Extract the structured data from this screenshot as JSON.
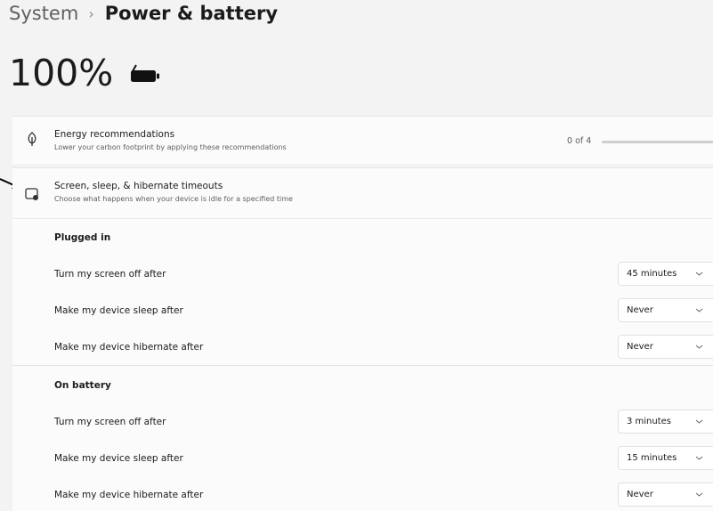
{
  "breadcrumb": {
    "root": "System",
    "separator": "›",
    "current": "Power & battery"
  },
  "battery": {
    "percent": "100%",
    "icon": "battery-charging-icon"
  },
  "energy_recommendations": {
    "icon": "leaf-icon",
    "title": "Energy recommendations",
    "subtitle": "Lower your carbon footprint by applying these recommendations",
    "progress_label": "0 of 4",
    "progress_fraction": 0
  },
  "timeouts": {
    "icon": "screen-sleep-icon",
    "title": "Screen, sleep, & hibernate timeouts",
    "subtitle": "Choose what happens when your device is idle for a specified time",
    "plugged_in": {
      "title": "Plugged in",
      "screen_off": {
        "label": "Turn my screen off after",
        "value": "45 minutes"
      },
      "sleep": {
        "label": "Make my device sleep after",
        "value": "Never"
      },
      "hibernate": {
        "label": "Make my device hibernate after",
        "value": "Never"
      }
    },
    "on_battery": {
      "title": "On battery",
      "screen_off": {
        "label": "Turn my screen off after",
        "value": "3 minutes"
      },
      "sleep": {
        "label": "Make my device sleep after",
        "value": "15 minutes"
      },
      "hibernate": {
        "label": "Make my device hibernate after",
        "value": "Never"
      }
    }
  },
  "colors": {
    "accent": "#0067c0",
    "background": "#f3f3f3",
    "card": "#fbfbfb"
  }
}
